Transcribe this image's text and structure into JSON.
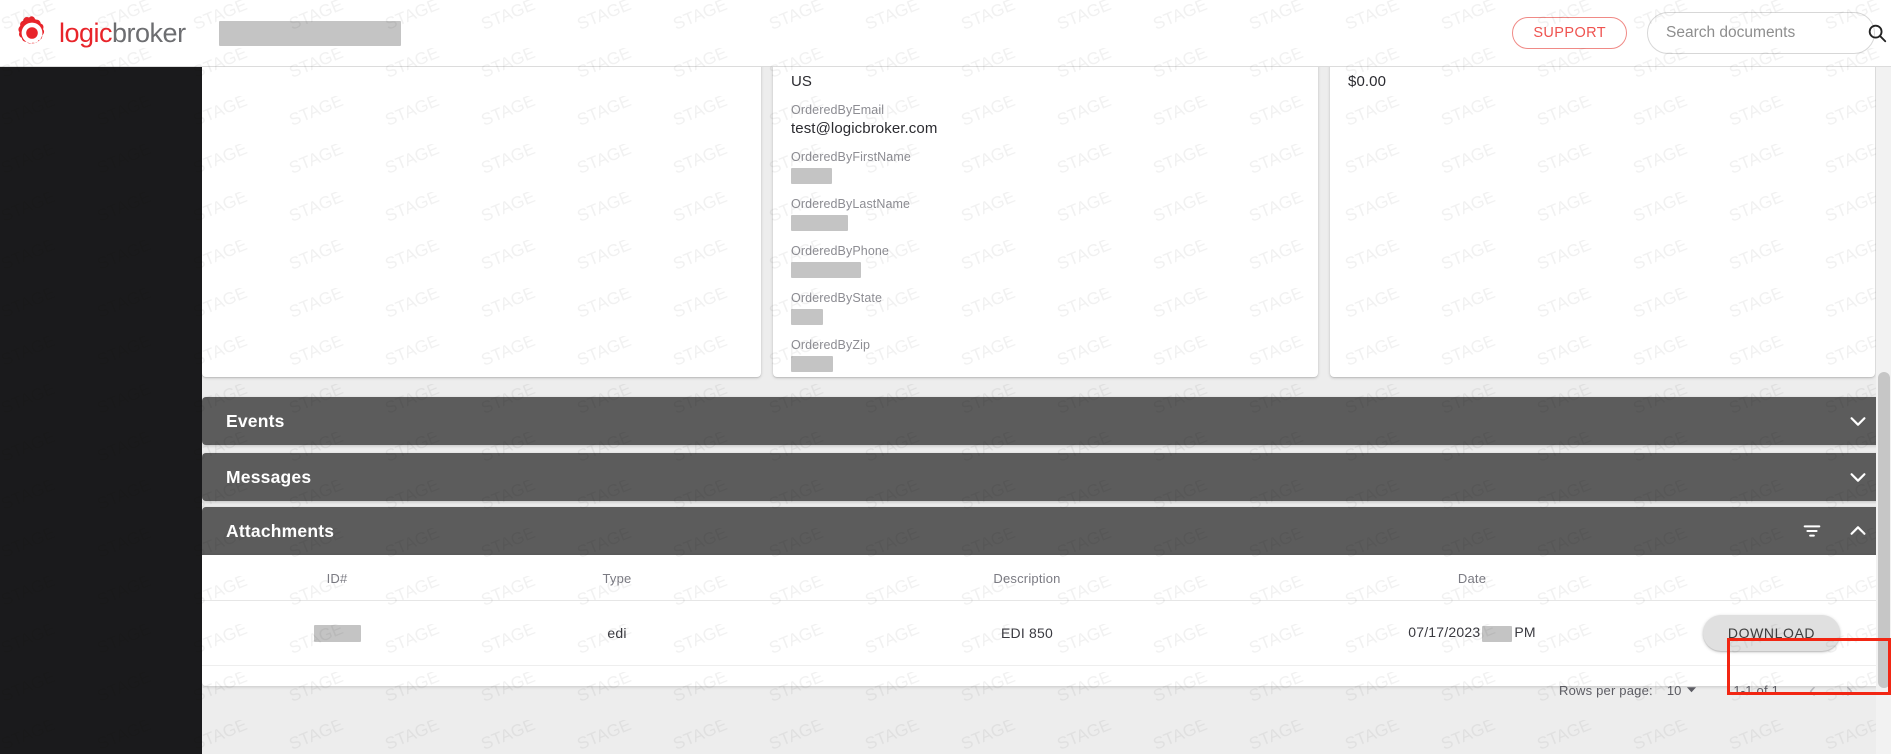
{
  "header": {
    "brand_logic": "logic",
    "brand_broker": "broker",
    "support_label": "SUPPORT",
    "search_placeholder": "Search documents",
    "search_value": ""
  },
  "cards": {
    "middle": {
      "fields": [
        {
          "label": "",
          "value": "US",
          "redacted": false
        },
        {
          "label": "OrderedByEmail",
          "value": "test@logicbroker.com",
          "redacted": false
        },
        {
          "label": "OrderedByFirstName",
          "value": "",
          "redacted": true,
          "redact_width": 41
        },
        {
          "label": "OrderedByLastName",
          "value": "",
          "redacted": true,
          "redact_width": 57
        },
        {
          "label": "OrderedByPhone",
          "value": "",
          "redacted": true,
          "redact_width": 70
        },
        {
          "label": "OrderedByState",
          "value": "",
          "redacted": true,
          "redact_width": 32
        },
        {
          "label": "OrderedByZip",
          "value": "",
          "redacted": true,
          "redact_width": 42
        }
      ]
    },
    "right": {
      "amount": "$0.00"
    }
  },
  "panels": [
    {
      "title": "Events",
      "expanded": false,
      "has_filter": false
    },
    {
      "title": "Messages",
      "expanded": false,
      "has_filter": false
    },
    {
      "title": "Attachments",
      "expanded": true,
      "has_filter": true
    }
  ],
  "attachments": {
    "title": "Attachments",
    "columns": [
      "ID#",
      "Type",
      "Description",
      "Date",
      ""
    ],
    "rows": [
      {
        "id": "",
        "id_redacted": true,
        "type": "edi",
        "description": "EDI 850",
        "date": "07/17/2023",
        "time_redacted": true,
        "meridiem": "PM",
        "action_label": "DOWNLOAD"
      }
    ],
    "pagination": {
      "rows_per_page_label": "Rows per page:",
      "rows_per_page_value": "10",
      "range": "1-1 of 1",
      "prev_glyph": "‹",
      "next_glyph": "›"
    }
  },
  "watermark": {
    "text": "STAGE"
  },
  "colors": {
    "brand_red": "#e8242a",
    "panel_gray": "#5c5c5c",
    "page_bg": "#ededed",
    "sidebar": "#1a1a1c",
    "annotation": "#f22613"
  }
}
